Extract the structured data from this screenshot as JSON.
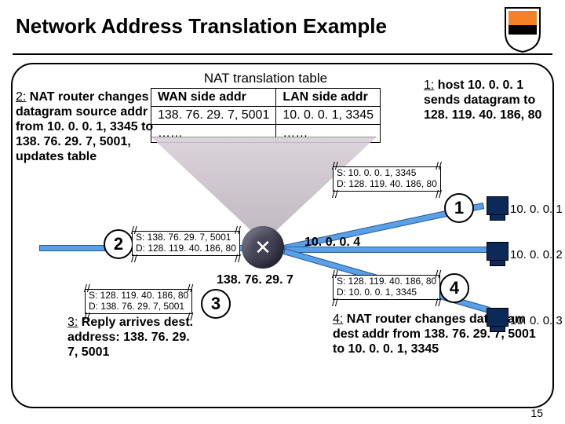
{
  "title": "Network Address Translation Example",
  "slide_number": "15",
  "nat_table": {
    "caption": "NAT translation table",
    "headers": [
      "WAN side addr",
      "LAN side addr"
    ],
    "rows": [
      [
        "138. 76. 29. 7, 5001",
        "10. 0. 0. 1, 3345"
      ],
      [
        "……",
        "……"
      ]
    ]
  },
  "steps": {
    "s1": {
      "num": "1:",
      "text": " host 10. 0. 0. 1 sends datagram to 128. 119. 40. 186, 80"
    },
    "s2": {
      "num": "2:",
      "text": " NAT router changes datagram source addr from 10. 0. 0. 1, 3345 to 138. 76. 29. 7, 5001, updates table"
    },
    "s3": {
      "num": "3:",
      "text": " Reply arrives dest. address: 138. 76. 29. 7, 5001"
    },
    "s4": {
      "num": "4:",
      "text": " NAT router changes datagram dest addr from 138. 76. 29. 7, 5001 to 10. 0. 0. 1, 3345"
    }
  },
  "packets": {
    "p1": {
      "src": "S: 10. 0. 0. 1, 3345",
      "dst": "D: 128. 119. 40. 186, 80"
    },
    "p2": {
      "src": "S: 138. 76. 29. 7, 5001",
      "dst": "D: 128. 119. 40. 186, 80"
    },
    "p3": {
      "src": "S: 128. 119. 40. 186, 80",
      "dst": "D: 138. 76. 29. 7, 5001"
    },
    "p4": {
      "src": "S: 128. 119. 40. 186, 80",
      "dst": "D: 10. 0. 0. 1, 3345"
    }
  },
  "router": {
    "wan_ip": "138. 76. 29. 7",
    "lan_ip": "10. 0. 0. 4"
  },
  "hosts": {
    "h1": "10. 0. 0. 1",
    "h2": "10. 0. 0. 2",
    "h3": "10. 0. 0. 3"
  },
  "bubbles": {
    "b1": "1",
    "b2": "2",
    "b3": "3",
    "b4": "4"
  }
}
